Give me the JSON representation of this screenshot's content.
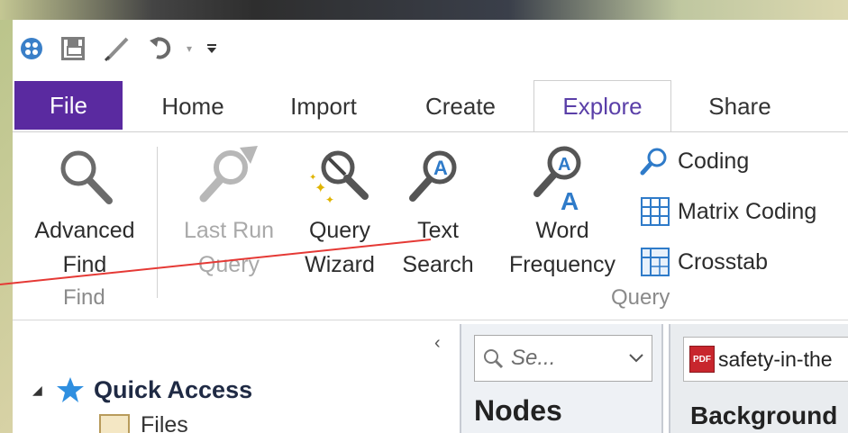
{
  "quick_access_toolbar": {
    "items": [
      "app-menu",
      "save",
      "edit",
      "undo",
      "undo-dropdown",
      "customize"
    ],
    "undo_dropdown_glyph": "▾",
    "customize_glyph": "▾"
  },
  "tabs": {
    "file": "File",
    "home": "Home",
    "import": "Import",
    "create": "Create",
    "explore": "Explore",
    "share": "Share"
  },
  "ribbon": {
    "find_group": {
      "label": "Find",
      "advanced_find": {
        "line1": "Advanced",
        "line2": "Find"
      }
    },
    "query_group": {
      "label": "Query",
      "last_run_query": {
        "line1": "Last Run",
        "line2": "Query",
        "disabled": true
      },
      "query_wizard": {
        "line1": "Query",
        "line2": "Wizard"
      },
      "text_search": {
        "line1": "Text",
        "line2": "Search"
      },
      "word_frequency": {
        "line1": "Word",
        "line2": "Frequency"
      },
      "coding": "Coding",
      "matrix_coding": "Matrix Coding",
      "crosstab": "Crosstab"
    }
  },
  "navigation": {
    "collapse_glyph": "‹",
    "quick_access": {
      "arrow": "◢",
      "label": "Quick Access"
    },
    "files_label": "Files"
  },
  "list_view": {
    "search_placeholder": "Se...",
    "heading": "Nodes"
  },
  "detail_view": {
    "document_tab": "safety-in-the",
    "pdf_icon_text": "PDF",
    "content_heading": "Background"
  },
  "colors": {
    "file_tab": "#5a2aa0",
    "explore_text": "#5a3fa8",
    "accent_blue": "#2f7bc9",
    "annotation_line": "#e53935"
  }
}
